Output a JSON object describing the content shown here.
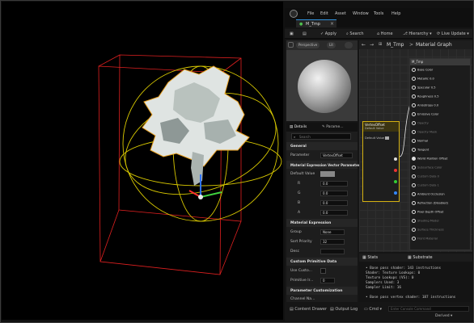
{
  "window": {
    "logo": "unreal-engine-logo",
    "menu": [
      "File",
      "Edit",
      "Asset",
      "Window",
      "Tools",
      "Help"
    ],
    "tab_title": "M_Tmp"
  },
  "toolbar": {
    "apply": "Apply",
    "search": "Search",
    "home": "Home",
    "hierarchy": "Hierarchy",
    "live_update": "Live Update"
  },
  "preview": {
    "mode": "Perspective",
    "lit": "Lit"
  },
  "graph": {
    "breadcrumb_root": "M_Tmp",
    "breadcrumb_sep": ">",
    "breadcrumb_current": "Material Graph",
    "param_node": {
      "title": "VertexOffset",
      "subtitle": "Default Value",
      "pin": "Default Value"
    },
    "main_node": {
      "title": "M_Tmp",
      "pins": [
        {
          "label": "Base Color",
          "active": true
        },
        {
          "label": "Metallic",
          "active": true,
          "value": "0.0"
        },
        {
          "label": "Specular",
          "active": true,
          "value": "0.5"
        },
        {
          "label": "Roughness",
          "active": true,
          "value": "0.5"
        },
        {
          "label": "Anisotropy",
          "active": true,
          "value": "0.0"
        },
        {
          "label": "Emissive Color",
          "active": true
        },
        {
          "label": "Opacity",
          "active": false
        },
        {
          "label": "Opacity Mask",
          "active": false
        },
        {
          "label": "Normal",
          "active": true
        },
        {
          "label": "Tangent",
          "active": true
        },
        {
          "label": "World Position Offset",
          "active": true
        },
        {
          "label": "Subsurface Color",
          "active": false
        },
        {
          "label": "Custom Data 0",
          "active": false
        },
        {
          "label": "Custom Data 1",
          "active": false
        },
        {
          "label": "Ambient Occlusion",
          "active": true
        },
        {
          "label": "Refraction (Disabled)",
          "active": true
        },
        {
          "label": "Pixel Depth Offset",
          "active": true
        },
        {
          "label": "Shading Model",
          "active": false
        },
        {
          "label": "Surface Thickness",
          "active": false
        },
        {
          "label": "Front Material",
          "active": false
        }
      ]
    }
  },
  "details": {
    "tab_details": "Details",
    "tab_params": "Parame...",
    "search_placeholder": "Search",
    "general_header": "General",
    "parameter_label": "Parameter",
    "parameter_value": "VertexOffset",
    "section_mevp": "Material Expression Vector Parameter",
    "default_value_label": "Default Value",
    "components": [
      {
        "label": "R",
        "value": "0.0"
      },
      {
        "label": "G",
        "value": "0.0"
      },
      {
        "label": "B",
        "value": "0.0"
      },
      {
        "label": "A",
        "value": "0.0"
      }
    ],
    "section_mat_expr": "Material Expression",
    "group_label": "Group",
    "group_value": "None",
    "sort_priority_label": "Sort Priority",
    "sort_priority_value": "32",
    "desc_label": "Desc",
    "section_custom_prim": "Custom Primitive Data",
    "use_custom_label": "Use Custo...",
    "primitive_label": "Primitive Ir...",
    "primitive_value": "0",
    "section_param_custom": "Parameter Customization",
    "channel_names": "Channel Na..."
  },
  "stats": {
    "tab_stats": "Stats",
    "tab_substrate": "Substrate",
    "lines": [
      "• Base pass shader: 143 instructions",
      "  Shader: Texture Lookups: 0",
      "  Texture Lookups (VS): 0",
      "  Samplers Used: 3",
      "  Sampler Limit: 16",
      "",
      "• Base pass vertex shader: 187 instructions"
    ]
  },
  "bottom": {
    "content_drawer": "Content Drawer",
    "output_log": "Output Log",
    "cmd": "Cmd",
    "console_placeholder": "Enter Console Command",
    "derived": "Derived"
  }
}
